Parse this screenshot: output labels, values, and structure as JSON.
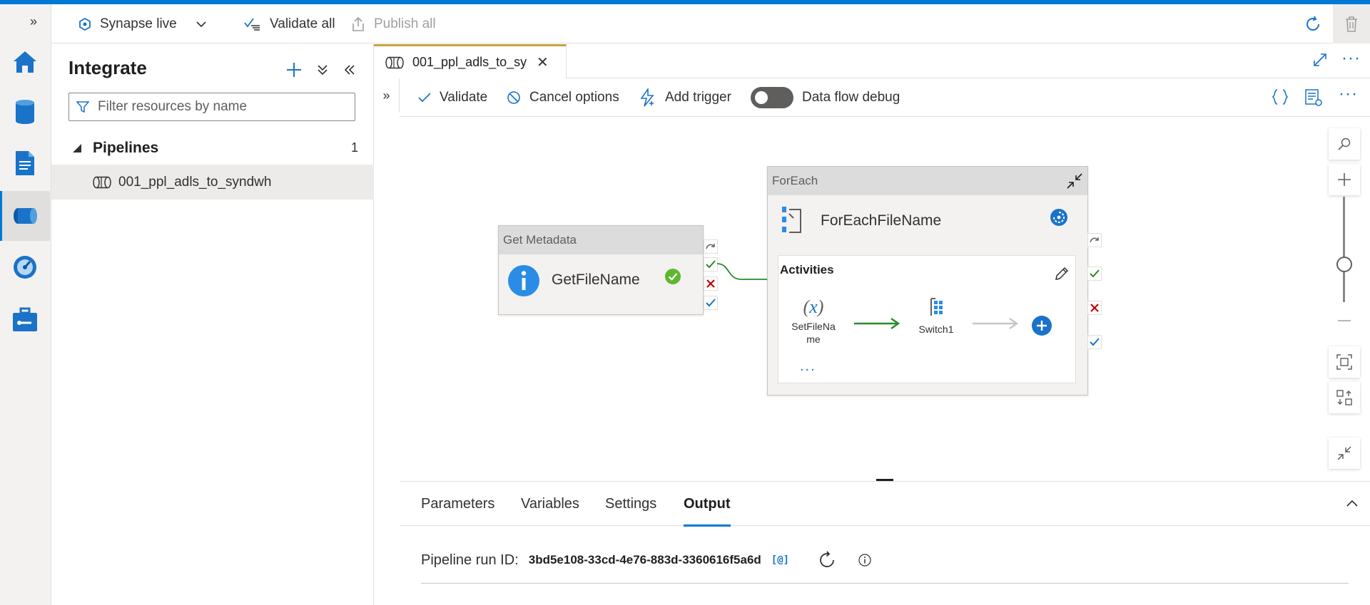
{
  "app": {
    "accent": "#0078d4",
    "tab_accent": "#c8a43c"
  },
  "topbar": {
    "workspace_label": "Synapse live",
    "validate_all_label": "Validate all",
    "publish_all_label": "Publish all"
  },
  "rail": {
    "icons": [
      "expand-icon",
      "home-icon",
      "data-icon",
      "develop-icon",
      "integrate-icon",
      "monitor-icon",
      "manage-icon"
    ],
    "active": "integrate-icon"
  },
  "panel": {
    "title": "Integrate",
    "filter_placeholder": "Filter resources by name",
    "group_label": "Pipelines",
    "group_count": "1",
    "items": [
      {
        "label": "001_ppl_adls_to_syndwh"
      }
    ]
  },
  "tab": {
    "label": "001_ppl_adls_to_sy..."
  },
  "cmdbar": {
    "validate_label": "Validate",
    "cancel_label": "Cancel options",
    "trigger_label": "Add trigger",
    "debug_label": "Data flow debug"
  },
  "canvas": {
    "get_metadata": {
      "type_label": "Get Metadata",
      "name": "GetFileName",
      "status_color": "#5cb82c"
    },
    "foreach": {
      "type_label": "ForEach",
      "name": "ForEachFileName",
      "activities_label": "Activities",
      "set_variable_name": "SetFileNa\nme",
      "set_variable_line1": "SetFileNa",
      "set_variable_line2": "me",
      "switch_name": "Switch1",
      "more_label": "..."
    }
  },
  "bottom": {
    "tabs": [
      "Parameters",
      "Variables",
      "Settings",
      "Output"
    ],
    "active_tab": "Output",
    "run_id_label": "Pipeline run ID:",
    "run_id_value": "3bd5e108-33cd-4e76-883d-3360616f5a6d"
  }
}
